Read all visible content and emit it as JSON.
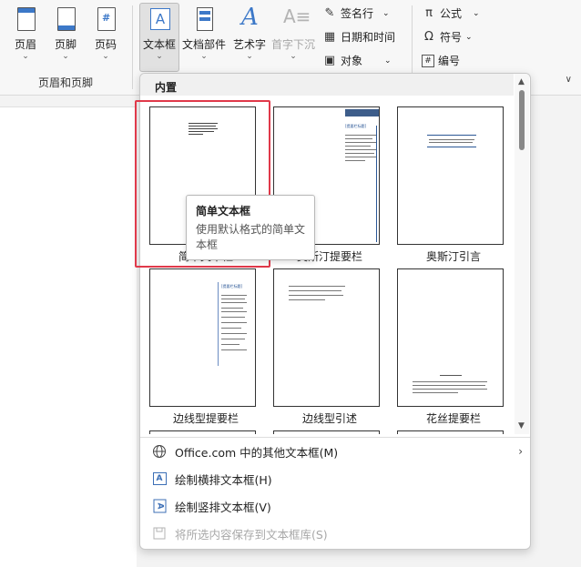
{
  "ribbon": {
    "buttons": [
      {
        "label": "页眉"
      },
      {
        "label": "页脚"
      },
      {
        "label": "页码",
        "icon_glyph": "#"
      },
      {
        "label": "文本框",
        "icon_glyph": "A"
      },
      {
        "label": "文档部件"
      },
      {
        "label": "艺术字",
        "icon_glyph": "A"
      },
      {
        "label": "首字下沉",
        "icon_glyph": "A≡"
      }
    ],
    "small": [
      {
        "label": "签名行",
        "icon": "✎"
      },
      {
        "label": "日期和时间",
        "icon": "▦"
      },
      {
        "label": "对象",
        "icon": "▣"
      },
      {
        "label": "公式",
        "icon": "π"
      },
      {
        "label": "符号",
        "icon": "Ω"
      },
      {
        "label": "编号",
        "icon": "#"
      }
    ],
    "group_label": "页眉和页脚",
    "collapse_icon": "∨"
  },
  "panel": {
    "section_title": "内置",
    "tiles": [
      {
        "label": "简单文本框"
      },
      {
        "label": "奥斯汀提要栏"
      },
      {
        "label": "奥斯汀引言"
      },
      {
        "label": "边线型提要栏"
      },
      {
        "label": "边线型引述"
      },
      {
        "label": "花丝提要栏"
      }
    ],
    "thumb_text": "[提要栏标题]",
    "tooltip": {
      "title": "简单文本框",
      "description": "使用默认格式的简单文本框"
    },
    "menu": [
      {
        "label": "Office.com 中的其他文本框(M)",
        "icon": "globe-icon",
        "enabled": true,
        "submenu": true
      },
      {
        "label": "绘制横排文本框(H)",
        "icon": "horizontal-textbox-icon",
        "enabled": true
      },
      {
        "label": "绘制竖排文本框(V)",
        "icon": "vertical-textbox-icon",
        "enabled": true
      },
      {
        "label": "将所选内容保存到文本框库(S)",
        "icon": "save-icon",
        "enabled": false
      }
    ]
  },
  "colors": {
    "accent": "#2b5796",
    "highlight": "#e0394a"
  }
}
